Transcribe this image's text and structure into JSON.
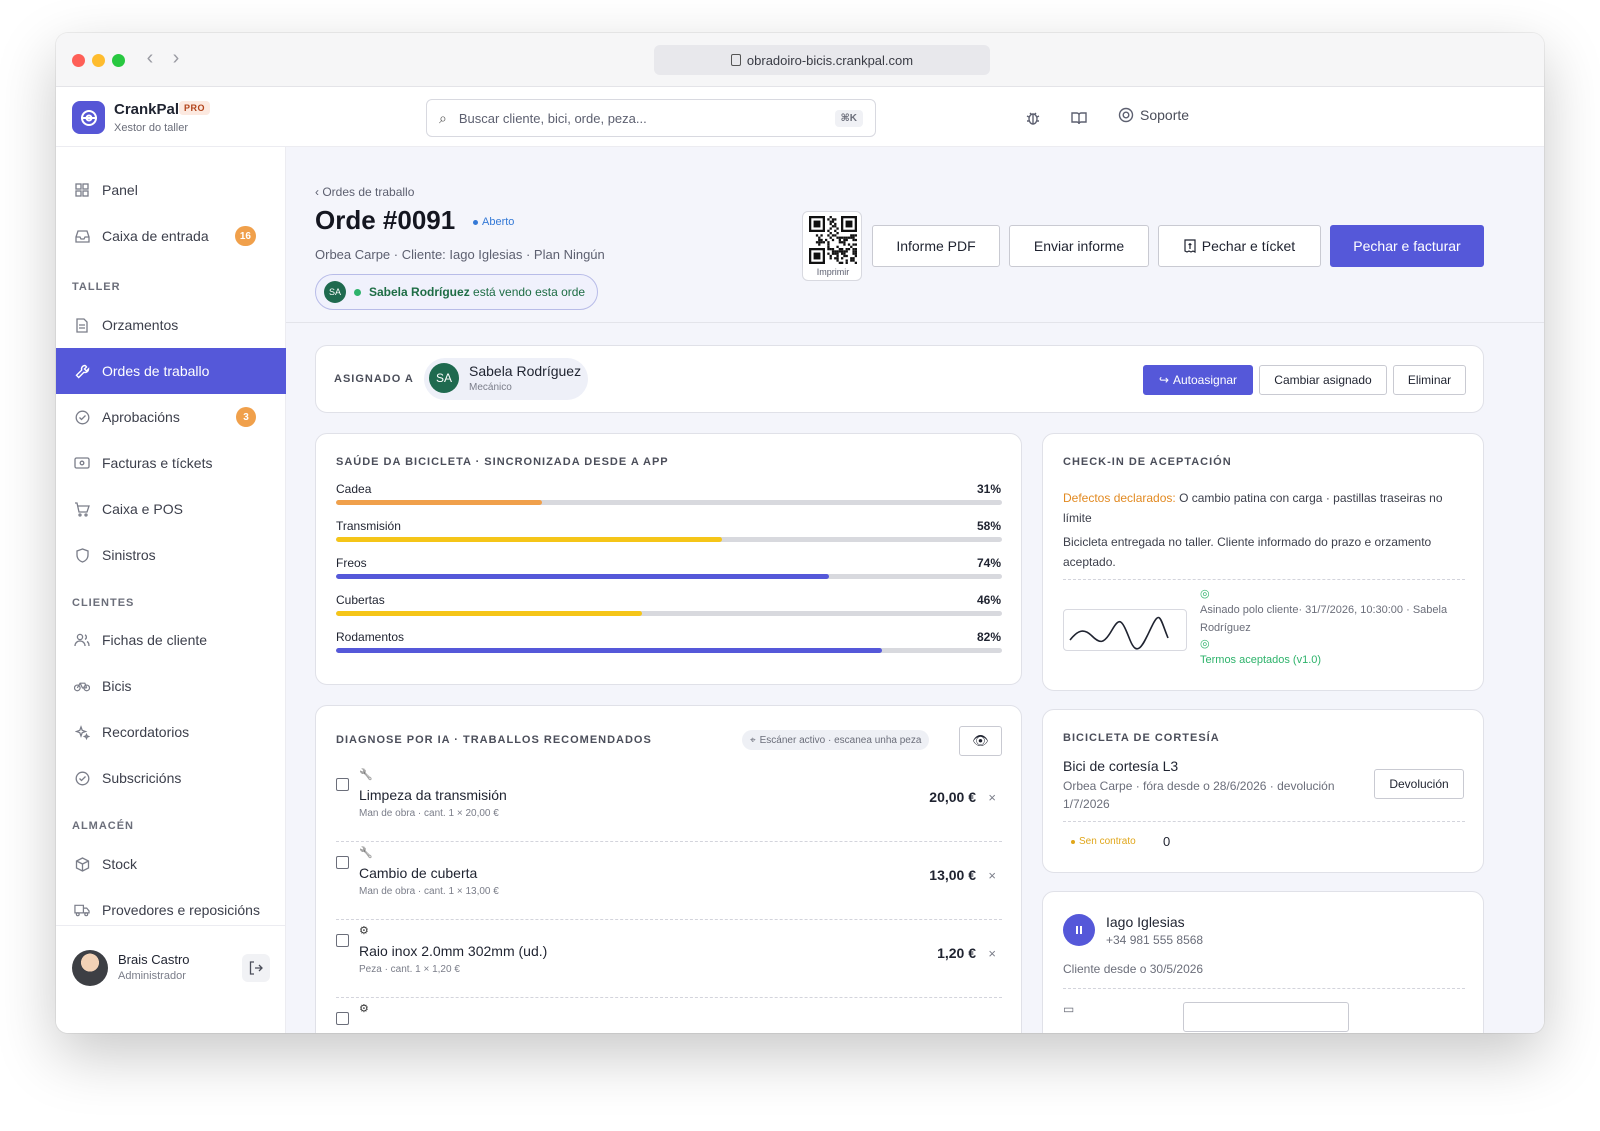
{
  "browser": {
    "url": "obradoiro-bicis.crankpal.com"
  },
  "brand": {
    "name": "CrankPal",
    "badge": "PRO",
    "subtitle": "Xestor do taller"
  },
  "search": {
    "placeholder": "Buscar cliente, bici, orde, peza...",
    "shortcut": "⌘K"
  },
  "header": {
    "support_label": "Soporte"
  },
  "sidebar": {
    "items_top": [
      {
        "label": "Panel",
        "icon": "grid-icon"
      },
      {
        "label": "Caixa de entrada",
        "icon": "inbox-icon",
        "badge": "16"
      }
    ],
    "section_taller": "TALLER",
    "items_taller": [
      {
        "label": "Orzamentos",
        "icon": "document-icon"
      },
      {
        "label": "Ordes de traballo",
        "icon": "wrench-icon",
        "active": true
      },
      {
        "label": "Aprobacións",
        "icon": "check-circle-icon",
        "badge": "3"
      },
      {
        "label": "Facturas e tíckets",
        "icon": "ticket-icon"
      },
      {
        "label": "Caixa e POS",
        "icon": "cart-icon"
      },
      {
        "label": "Sinistros",
        "icon": "shield-icon"
      }
    ],
    "section_clientes": "CLIENTES",
    "items_clientes": [
      {
        "label": "Fichas de cliente",
        "icon": "users-icon"
      },
      {
        "label": "Bicis",
        "icon": "bike-icon"
      },
      {
        "label": "Recordatorios",
        "icon": "sparkle-icon"
      },
      {
        "label": "Subscricións",
        "icon": "check-circle-icon"
      }
    ],
    "section_almacen": "ALMACÉN",
    "items_almacen": [
      {
        "label": "Stock",
        "icon": "box-icon"
      },
      {
        "label": "Provedores e reposicións",
        "icon": "truck-icon"
      }
    ],
    "user": {
      "name": "Brais Castro",
      "role": "Administrador"
    }
  },
  "order": {
    "breadcrumb": "‹ Ordes de traballo",
    "title": "Orde #0091",
    "status": "Aberto",
    "subtitle": "Orbea Carpe · Cliente: Iago Iglesias · Plan Ningún",
    "viewer_initials": "SA",
    "viewer_name": "Sabela Rodríguez",
    "viewer_text": " está vendo esta orde",
    "qr_label": "Imprimir",
    "actions": {
      "pdf": "Informe PDF",
      "send": "Enviar informe",
      "close_ticket": "Pechar e tícket",
      "close_invoice": "Pechar e facturar"
    }
  },
  "assign": {
    "title": "ASIGNADO A",
    "initials": "SA",
    "name": "Sabela Rodríguez",
    "role": "Mecánico",
    "self_assign": "Autoasignar",
    "change": "Cambiar asignado",
    "remove": "Eliminar"
  },
  "health": {
    "title": "SAÚDE DA BICICLETA · SINCRONIZADA DESDE A APP",
    "rows": [
      {
        "label": "Cadea",
        "pct_label": "31%",
        "value": 0.31,
        "color": "#f0a04b"
      },
      {
        "label": "Transmisión",
        "pct_label": "58%",
        "value": 0.58,
        "color": "#f5c518"
      },
      {
        "label": "Freos",
        "pct_label": "74%",
        "value": 0.74,
        "color": "#5558d9"
      },
      {
        "label": "Cubertas",
        "pct_label": "46%",
        "value": 0.46,
        "color": "#f5c518"
      },
      {
        "label": "Rodamentos",
        "pct_label": "82%",
        "value": 0.82,
        "color": "#5558d9"
      }
    ]
  },
  "checkin": {
    "title": "CHECK-IN DE ACEPTACIÓN",
    "defects_label": "Defectos declarados:",
    "defects_text": " O cambio patina con carga · pastillas traseiras no límite",
    "delivered_text": "Bicicleta entregada no taller. Cliente informado do prazo e orzamento aceptado.",
    "signed_text": "Asinado polo cliente· 31/7/2026, 10:30:00 · Sabela Rodríguez",
    "terms_text": "Termos aceptados (v1.0)"
  },
  "diagnosis": {
    "title": "DIAGNOSE POR IA · TRABALLOS RECOMENDADOS",
    "scanner": "Escáner activo · escanea unha peza",
    "items": [
      {
        "icon": "wrench-icon",
        "name": "Limpeza da transmisión",
        "meta": "Man de obra · cant. 1 × 20,00 €",
        "price": "20,00 €"
      },
      {
        "icon": "wrench-icon",
        "name": "Cambio de cuberta",
        "meta": "Man de obra · cant. 1 × 13,00 €",
        "price": "13,00 €"
      },
      {
        "icon": "gear-icon",
        "name": "Raio inox 2.0mm 302mm (ud.)",
        "meta": "Peza · cant. 1 × 1,20 €",
        "price": "1,20 €"
      },
      {
        "icon": "gear-icon",
        "name": "",
        "meta": "",
        "price": ""
      }
    ]
  },
  "courtesy": {
    "title": "BICICLETA DE CORTESÍA",
    "bike_name": "Bici de cortesía L3",
    "bike_sub": "Orbea Carpe · fóra desde o 28/6/2026 · devolución 1/7/2026",
    "return_btn": "Devolución",
    "contract": "Sen contrato",
    "count": "0"
  },
  "customer": {
    "initials": "II",
    "name": "Iago Iglesias",
    "phone": "+34 981 555 8568",
    "since": "Cliente desde o 30/5/2026"
  }
}
